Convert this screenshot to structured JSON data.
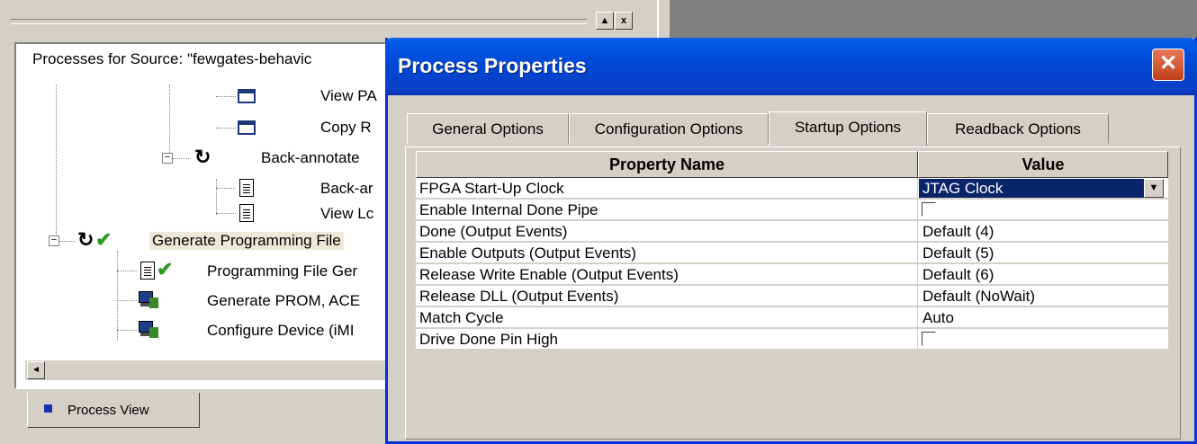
{
  "process_pane": {
    "header": "Processes for Source:  \"fewgates-behavic",
    "tree": [
      {
        "label": "View PA",
        "icon": "window-icon"
      },
      {
        "label": "Copy R",
        "icon": "window-icon"
      },
      {
        "label": "Back-annotate",
        "icon": "cycle-icon"
      },
      {
        "label": "Back-ar",
        "icon": "document-icon"
      },
      {
        "label": "View Lc",
        "icon": "document-icon"
      },
      {
        "label": "Generate Programming File",
        "icon": "cycle-check-icon"
      },
      {
        "label": "Programming File Ger",
        "icon": "document-check-icon"
      },
      {
        "label": "Generate PROM, ACE",
        "icon": "computer-icon"
      },
      {
        "label": "Configure Device (iMI",
        "icon": "computer-icon"
      }
    ],
    "bottom_tab": "Process View",
    "top_buttons": {
      "up": "▲",
      "close": "x"
    },
    "expander_symbol": "−"
  },
  "dialog": {
    "title": "Process Properties",
    "close_symbol": "✕",
    "tabs": [
      "General Options",
      "Configuration Options",
      "Startup Options",
      "Readback Options"
    ],
    "active_tab": "Startup Options",
    "columns": [
      "Property Name",
      "Value"
    ],
    "rows": [
      {
        "name": "FPGA Start-Up Clock",
        "value": "JTAG Clock",
        "type": "select"
      },
      {
        "name": "Enable Internal Done Pipe",
        "value": "",
        "type": "checkbox",
        "checked": false
      },
      {
        "name": "Done (Output Events)",
        "value": "Default (4)",
        "type": "text"
      },
      {
        "name": "Enable Outputs (Output Events)",
        "value": "Default (5)",
        "type": "text"
      },
      {
        "name": "Release Write Enable (Output Events)",
        "value": "Default (6)",
        "type": "text"
      },
      {
        "name": "Release DLL (Output Events)",
        "value": "Default (NoWait)",
        "type": "text"
      },
      {
        "name": "Match Cycle",
        "value": "Auto",
        "type": "text"
      },
      {
        "name": "Drive Done Pin High",
        "value": "",
        "type": "checkbox",
        "checked": false
      }
    ]
  },
  "symbols": {
    "dropdown": "▼",
    "left_arrow": "◄",
    "cycle": "↻",
    "check": "✔"
  },
  "colors": {
    "title_bar": "#0047d2",
    "selection": "#0a246a",
    "check": "#2a9a20"
  }
}
